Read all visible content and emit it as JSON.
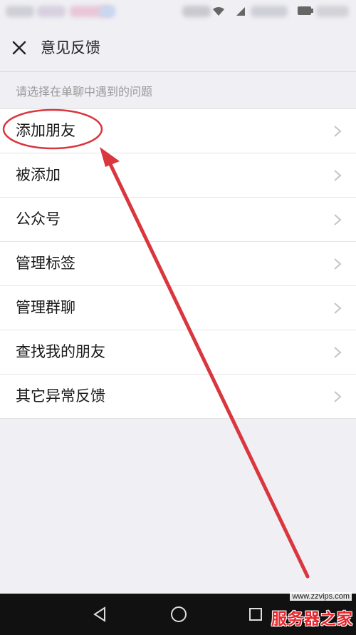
{
  "header": {
    "title": "意见反馈",
    "close_icon": "close-icon"
  },
  "section_hint": "请选择在单聊中遇到的问题",
  "list": {
    "items": [
      {
        "label": "添加朋友",
        "highlighted": true
      },
      {
        "label": "被添加"
      },
      {
        "label": "公众号"
      },
      {
        "label": "管理标签"
      },
      {
        "label": "管理群聊"
      },
      {
        "label": "查找我的朋友"
      },
      {
        "label": "其它异常反馈"
      }
    ]
  },
  "annotation": {
    "color": "#d9363e"
  },
  "nav": {
    "back_icon": "triangle-back-icon",
    "home_icon": "circle-home-icon",
    "recent_icon": "square-recent-icon"
  },
  "watermark": {
    "url": "www.zzvips.com",
    "text": "服务器之家"
  },
  "colors": {
    "background": "#efeff4",
    "list_background": "#ffffff",
    "nav_background": "#111111",
    "hint_text": "#9a9a9a"
  }
}
